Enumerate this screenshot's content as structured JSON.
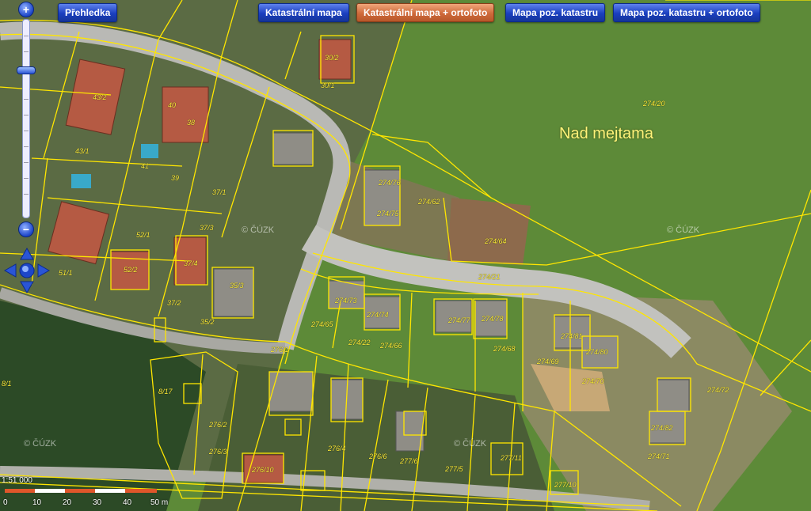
{
  "toolbar": {
    "overview_label": "Přehledka",
    "layers": [
      {
        "label": "Katastrální mapa",
        "active": false
      },
      {
        "label": "Katastrální mapa + ortofoto",
        "active": true
      },
      {
        "label": "Mapa poz. katastru",
        "active": false
      },
      {
        "label": "Mapa poz. katastru + ortofoto",
        "active": false
      }
    ]
  },
  "map": {
    "place_name": "Nad mejtama",
    "copyright": "© ČÚZK",
    "parcel_labels": [
      "274/20",
      "274/62",
      "274/64",
      "274/21",
      "274/65",
      "274/66",
      "274/68",
      "274/69",
      "274/70",
      "274/72",
      "274/71",
      "274/73",
      "274/74",
      "274/75",
      "274/76",
      "274/77",
      "274/78",
      "274/80",
      "274/81",
      "274/82",
      "274/22",
      "43/2",
      "43/1",
      "40",
      "38",
      "41",
      "39",
      "37/1",
      "37/3",
      "37/4",
      "37/2",
      "35/3",
      "35/2",
      "52/1",
      "52/2",
      "51/1",
      "30/2",
      "30/1",
      "276/1",
      "276/2",
      "276/3",
      "276/4",
      "276/6",
      "276/10",
      "277/5",
      "277/6",
      "277/10",
      "277/11",
      "8/17",
      "8/1"
    ],
    "colors": {
      "parcel_line": "#ffe600",
      "road": "#b9b9b5",
      "field": "#5d8a38",
      "forest": "#2c4a26"
    }
  },
  "scale": {
    "ratio": "1:51 000",
    "ticks": [
      "0",
      "10",
      "20",
      "30",
      "40",
      "50 m"
    ]
  },
  "icons": {
    "zoom_in": "plus-icon",
    "zoom_out": "minus-icon",
    "pan": "pan-arrows-icon"
  }
}
